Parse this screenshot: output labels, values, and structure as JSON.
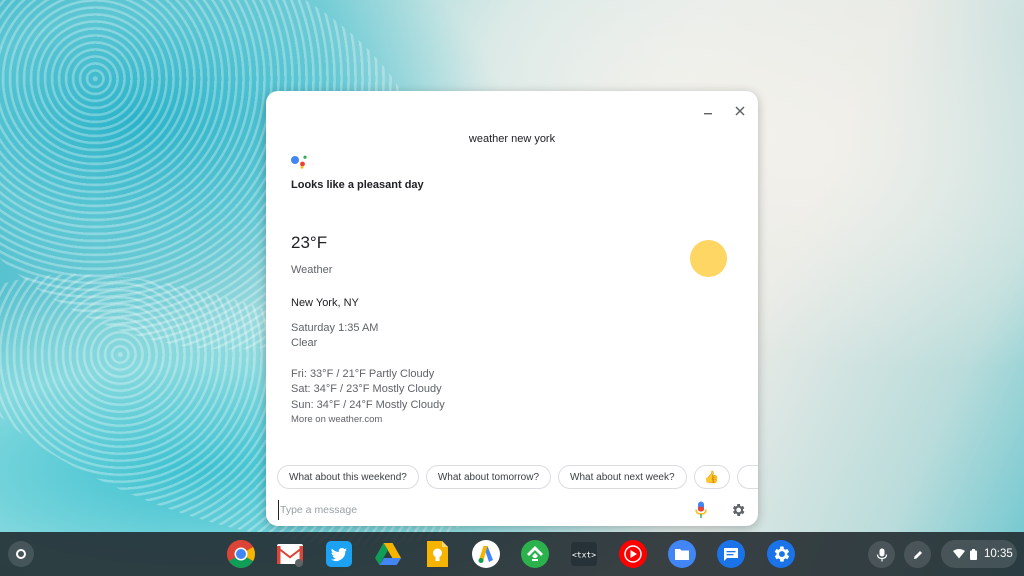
{
  "assistant": {
    "query": "weather new york",
    "response": "Looks like a pleasant day",
    "weather": {
      "temperature": "23°F",
      "label": "Weather",
      "location": "New York, NY",
      "time": "Saturday 1:35 AM",
      "condition": "Clear",
      "forecast": [
        "Fri: 33°F / 21°F Partly Cloudy",
        "Sat: 34°F / 23°F Mostly Cloudy",
        "Sun: 34°F / 24°F Mostly Cloudy"
      ],
      "source_link": "More on weather.com"
    },
    "suggestions": [
      "What about this weekend?",
      "What about tomorrow?",
      "What about next week?",
      "👍"
    ],
    "input_placeholder": "Type a message",
    "icons": {
      "minimize": "minimize-icon",
      "close": "close-icon",
      "mic": "microphone-icon",
      "settings": "gear-icon",
      "assistant": "google-assistant-icon",
      "weather": "sun-icon"
    },
    "colors": {
      "sun": "#fdd663",
      "panel": "#ffffff"
    }
  },
  "shelf": {
    "apps": [
      "Chrome",
      "Gmail",
      "Twitter",
      "Google Drive",
      "Google Keep",
      "Google Ads",
      "Feedly",
      "Text",
      "YouTube Music",
      "Files",
      "Messages",
      "Settings"
    ],
    "clock": "10:35"
  }
}
